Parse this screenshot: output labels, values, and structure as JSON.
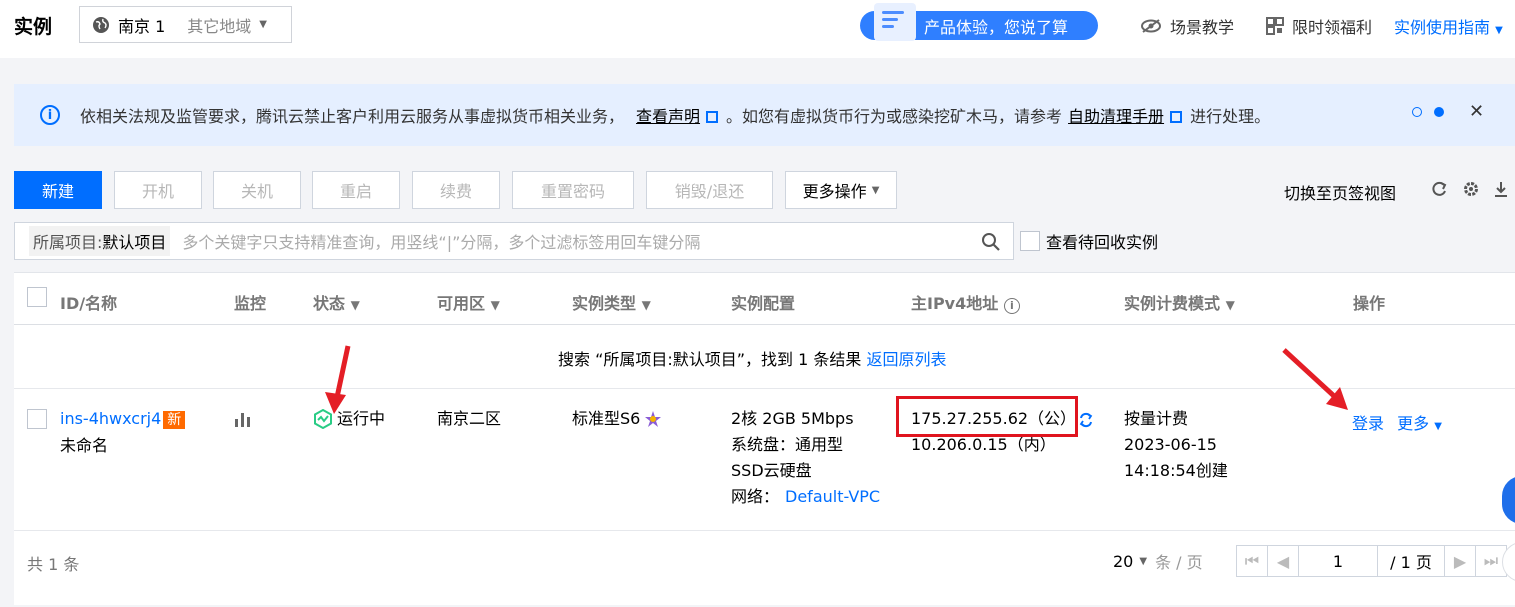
{
  "header": {
    "title": "实例",
    "region_selected": "南京 1",
    "region_other": "其它地域",
    "promo": "产品体验，您说了算",
    "links": {
      "tutorial": "场景教学",
      "welfare": "限时领福利",
      "guide": "实例使用指南"
    }
  },
  "notice": {
    "part1": "依相关法规及监管要求，腾讯云禁止客户利用云服务从事虚拟货币相关业务，",
    "link1": "查看声明",
    "part2": "。如您有虚拟货币行为或感染挖矿木马，请参考",
    "link2": "自助清理手册",
    "part3": "进行处理。"
  },
  "toolbar": {
    "create": "新建",
    "start": "开机",
    "stop": "关机",
    "restart": "重启",
    "renew": "续费",
    "reset_password": "重置密码",
    "destroy": "销毁/退还",
    "more": "更多操作",
    "switch_view": "切换至页签视图"
  },
  "search": {
    "tag_key": "所属项目:",
    "tag_value": "默认项目",
    "placeholder": "多个关键字只支持精准查询，用竖线“|”分隔，多个过滤标签用回车键分隔",
    "recycle_label": "查看待回收实例"
  },
  "table": {
    "headers": {
      "id": "ID/名称",
      "monitor": "监控",
      "status": "状态",
      "zone": "可用区",
      "type": "实例类型",
      "config": "实例配置",
      "ip": "主IPv4地址",
      "billing": "实例计费模式",
      "action": "操作"
    },
    "search_result": {
      "text": "搜索 “所属项目:默认项目”，找到 1 条结果",
      "back": "返回原列表"
    },
    "row": {
      "id": "ins-4hwxcrj4",
      "badge": "新",
      "name": "未命名",
      "status": "运行中",
      "zone": "南京二区",
      "type": "标准型S6",
      "config_line1": "2核 2GB 5Mbps",
      "config_line2": "系统盘：通用型",
      "config_line3": "SSD云硬盘",
      "network_label": "网络：",
      "network_value": "Default-VPC",
      "ip_public": "175.27.255.62（公）",
      "ip_private": "10.206.0.15（内）",
      "billing_mode": "按量计费",
      "created_date": "2023-06-15",
      "created_time": "14:18:54创建",
      "login": "登录",
      "more": "更多"
    }
  },
  "footer": {
    "total": "共 1 条",
    "page_size": "20",
    "per_page": "条 / 页",
    "current_page": "1",
    "total_pages": "/ 1 页"
  },
  "colors": {
    "primary": "#006eff",
    "warn": "#ff6a00",
    "running": "#29cc85",
    "annotation": "#e0141e"
  }
}
